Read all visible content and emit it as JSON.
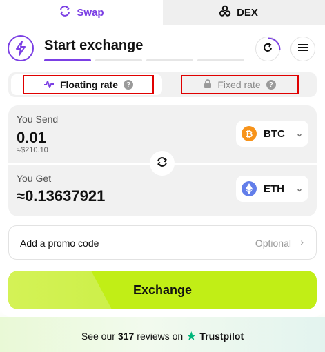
{
  "tabs": {
    "swap": "Swap",
    "dex": "DEX"
  },
  "header": {
    "title": "Start exchange",
    "steps_total": 4,
    "steps_active": 1
  },
  "rate": {
    "floating": "Floating rate",
    "fixed": "Fixed rate"
  },
  "send": {
    "label": "You Send",
    "amount": "0.01",
    "usd": "≈$210.10",
    "coin": "BTC",
    "coin_color": "#f7931a"
  },
  "get": {
    "label": "You Get",
    "amount": "≈0.13637921",
    "coin": "ETH",
    "coin_color": "#627eea"
  },
  "promo": {
    "label": "Add a promo code",
    "optional": "Optional"
  },
  "exchange_button": "Exchange",
  "footer": {
    "prefix": "See our",
    "count": "317",
    "mid": "reviews on",
    "brand": "Trustpilot"
  },
  "colors": {
    "accent": "#7b3fe4",
    "cta": "#c1ee16",
    "highlight_box": "#e00000",
    "trustpilot": "#00b67a"
  },
  "icons": [
    "swap-arrows-icon",
    "dex-icon",
    "lightning-logo-icon",
    "refresh-icon",
    "menu-icon",
    "pulse-icon",
    "lock-icon",
    "help-icon",
    "swap-direction-icon",
    "chevron-down-icon",
    "chevron-right-icon",
    "trustpilot-star-icon"
  ]
}
